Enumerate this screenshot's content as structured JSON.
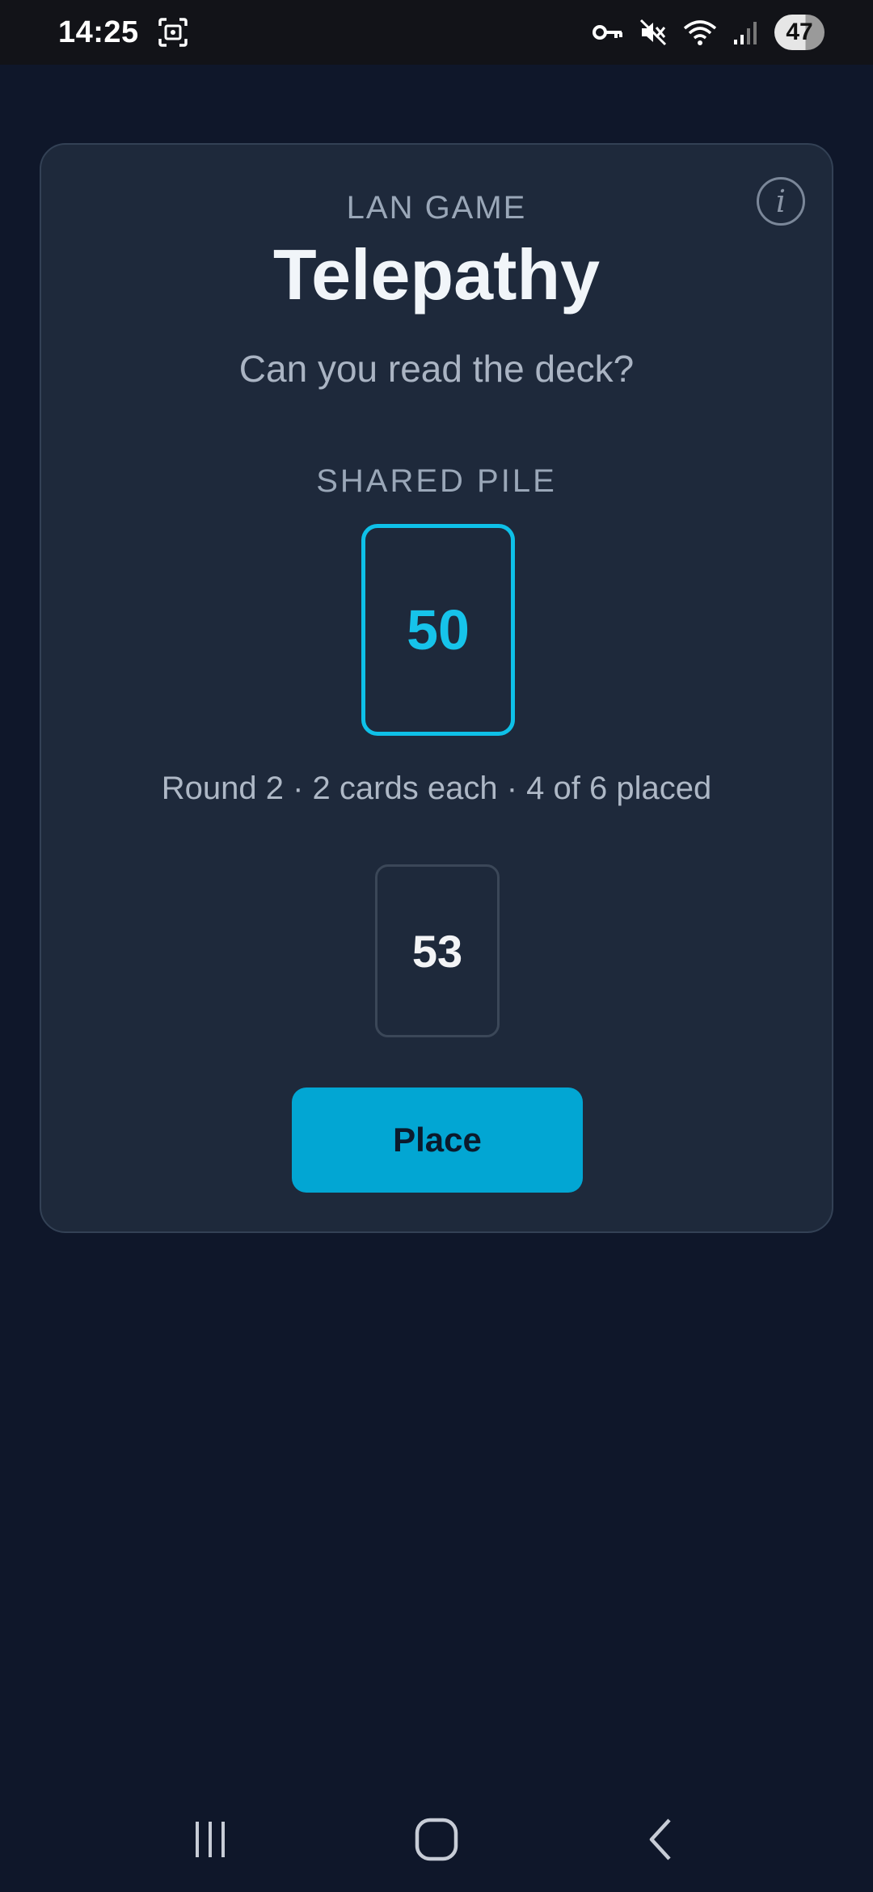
{
  "status_bar": {
    "time": "14:25",
    "battery": "47",
    "icons": [
      "screenshot-icon",
      "vpn-key-icon",
      "mute-icon",
      "wifi-icon",
      "signal-icon"
    ]
  },
  "game": {
    "eyebrow": "LAN GAME",
    "title": "Telepathy",
    "subtitle": "Can you read the deck?",
    "pile_label": "SHARED PILE",
    "pile_top_card": "50",
    "round_info": "Round 2 · 2 cards each · 4 of 6 placed",
    "hand_card": "53",
    "place_label": "Place",
    "info_glyph": "i"
  },
  "colors": {
    "background": "#0f172a",
    "card": "#1e293b",
    "accent": "#0ec0e8",
    "button": "#02a6d3"
  },
  "nav_bar": {
    "icons": [
      "recent-apps-icon",
      "home-icon",
      "back-icon"
    ]
  }
}
